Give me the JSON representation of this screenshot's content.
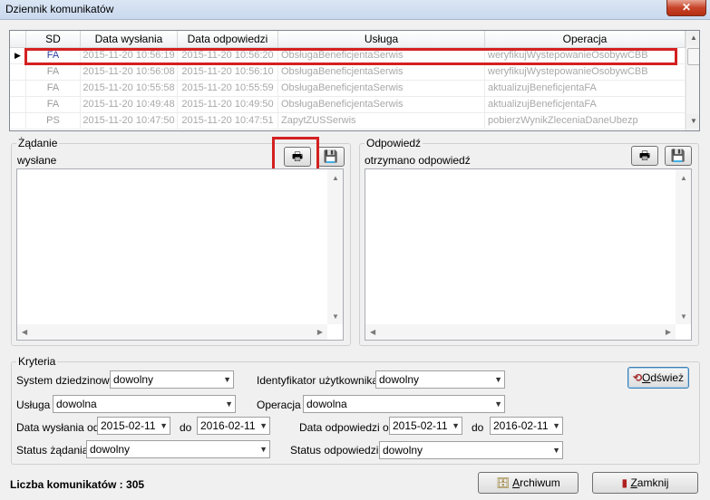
{
  "window": {
    "title": "Dziennik komunikatów",
    "close_glyph": "✕"
  },
  "grid": {
    "columns": [
      "SD",
      "Data wysłania",
      "Data odpowiedzi",
      "Usługa",
      "Operacja"
    ],
    "rows": [
      {
        "sd": "FA",
        "sent": "2015-11-20 10:56:19",
        "reply": "2015-11-20 10:56:20",
        "service": "ObsługaBeneficjentaSerwis",
        "operation": "weryfikujWystepowanieOsobywCBB"
      },
      {
        "sd": "FA",
        "sent": "2015-11-20 10:56:08",
        "reply": "2015-11-20 10:56:10",
        "service": "ObsługaBeneficjentaSerwis",
        "operation": "weryfikujWystepowanieOsobywCBB"
      },
      {
        "sd": "FA",
        "sent": "2015-11-20 10:55:58",
        "reply": "2015-11-20 10:55:59",
        "service": "ObsługaBeneficjentaSerwis",
        "operation": "aktualizujBeneficjentaFA"
      },
      {
        "sd": "FA",
        "sent": "2015-11-20 10:49:48",
        "reply": "2015-11-20 10:49:50",
        "service": "ObsługaBeneficjentaSerwis",
        "operation": "aktualizujBeneficjentaFA"
      },
      {
        "sd": "PS",
        "sent": "2015-11-20 10:47:50",
        "reply": "2015-11-20 10:47:51",
        "service": "ZapytZUSSerwis",
        "operation": "pobierzWynikZleceniaDaneUbezp"
      }
    ],
    "selected_row": 0
  },
  "request": {
    "group_label": "Żądanie",
    "status": "wysłane"
  },
  "response": {
    "group_label": "Odpowiedź",
    "status": "otrzymano odpowiedź"
  },
  "criteria": {
    "group_label": "Kryteria",
    "system_label": "System dziedzinowy",
    "system_value": "dowolny",
    "user_label": "Identyfikator użytkownika",
    "user_value": "dowolny",
    "service_label": "Usługa",
    "service_value": "dowolna",
    "operation_label": "Operacja",
    "operation_value": "dowolna",
    "sent_from_label": "Data wysłania od",
    "sent_from_value": "2015-02-11",
    "sent_to_label": "do",
    "sent_to_value": "2016-02-11",
    "reply_from_label": "Data odpowiedzi od",
    "reply_from_value": "2015-02-11",
    "reply_to_label": "do",
    "reply_to_value": "2016-02-11",
    "req_status_label": "Status żądania",
    "req_status_value": "dowolny",
    "resp_status_label": "Status odpowiedzi",
    "resp_status_value": "dowolny",
    "refresh_first": "O",
    "refresh_rest": "dśwież"
  },
  "footer": {
    "count_label": "Liczba komunikatów : 305",
    "archive_first": "A",
    "archive_rest": "rchiwum",
    "close_first": "Z",
    "close_rest": "amknij"
  },
  "colors": {
    "highlight": "#d42020",
    "selected_sd": "#2f3f9f"
  }
}
